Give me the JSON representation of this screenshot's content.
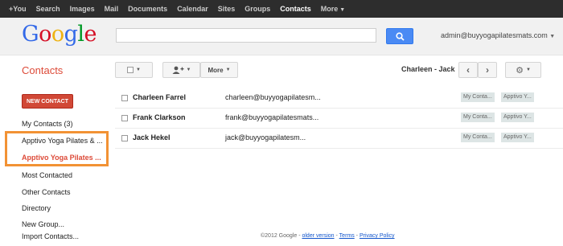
{
  "topnav": {
    "items": [
      "+You",
      "Search",
      "Images",
      "Mail",
      "Documents",
      "Calendar",
      "Sites",
      "Groups",
      "Contacts",
      "More"
    ],
    "active": "Contacts"
  },
  "header": {
    "logo_letters": [
      "G",
      "o",
      "o",
      "g",
      "l",
      "e"
    ],
    "logo_colors": [
      "#3369e8",
      "#d50f25",
      "#eeb211",
      "#3369e8",
      "#009925",
      "#d50f25"
    ],
    "search_value": "",
    "account": "admin@buyyogapilatesmats.com"
  },
  "page": {
    "title": "Contacts"
  },
  "toolbar": {
    "more_label": "More",
    "paging_text": "Charleen - Jack"
  },
  "sidebar": {
    "new_contact": "NEW CONTACT",
    "items": [
      {
        "label": "My Contacts (3)",
        "selected": false
      },
      {
        "label": "Apptivo Yoga Pilates & ...",
        "selected": false
      },
      {
        "label": "Apptivo Yoga Pilates ...",
        "selected": true
      },
      {
        "label": "Most Contacted",
        "selected": false
      },
      {
        "label": "Other Contacts",
        "selected": false
      },
      {
        "label": "Directory",
        "selected": false
      },
      {
        "label": "New Group...",
        "selected": false
      },
      {
        "label": "Import Contacts...",
        "selected": false
      }
    ]
  },
  "contacts": [
    {
      "name": "Charleen Farrel",
      "email": "charleen@buyyogapilatesm...",
      "groups": [
        "My Conta...",
        "Apptivo Y..."
      ]
    },
    {
      "name": "Frank Clarkson",
      "email": "frank@buyyogapilatesmats...",
      "groups": [
        "My Conta...",
        "Apptivo Y..."
      ]
    },
    {
      "name": "Jack Hekel",
      "email": "jack@buyyogapilatesm...",
      "groups": [
        "My Conta...",
        "Apptivo Y..."
      ]
    }
  ],
  "footer": {
    "copyright": "©2012 Google",
    "older_version": "older version",
    "terms": "Terms",
    "privacy": "Privacy Policy"
  },
  "colors": {
    "accent": "#dd4b39",
    "search_button": "#4a8af4",
    "highlight_border": "#f29234"
  }
}
